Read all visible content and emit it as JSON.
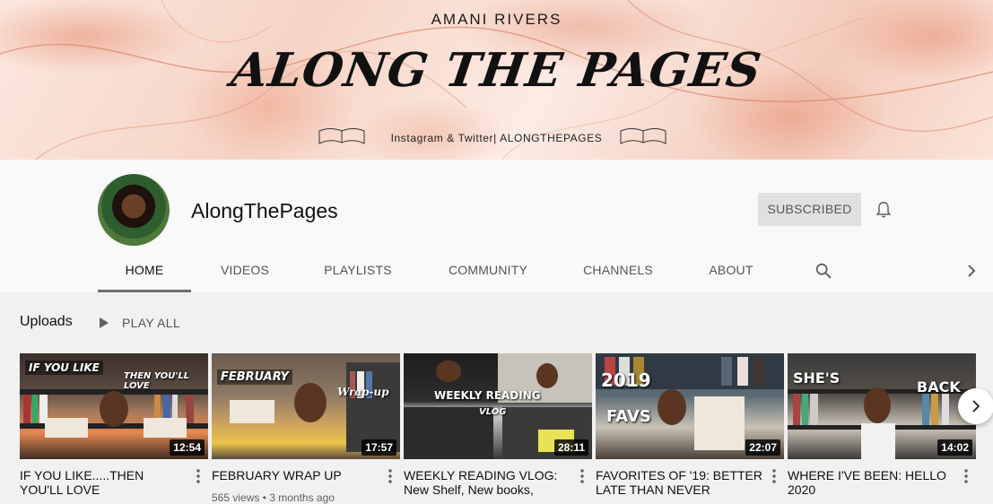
{
  "banner": {
    "name": "AMANI RIVERS",
    "title": "ALONG THE PAGES",
    "social": "Instagram & Twitter| ALONGTHEPAGES"
  },
  "channel": {
    "name": "AlongThePages",
    "subscribe_label": "SUBSCRIBED"
  },
  "tabs": [
    {
      "label": "HOME",
      "active": true
    },
    {
      "label": "VIDEOS"
    },
    {
      "label": "PLAYLISTS"
    },
    {
      "label": "COMMUNITY"
    },
    {
      "label": "CHANNELS"
    },
    {
      "label": "ABOUT"
    }
  ],
  "uploads": {
    "title": "Uploads",
    "play_all": "PLAY ALL",
    "videos": [
      {
        "title": "IF YOU LIKE.....THEN YOU'LL LOVE",
        "duration": "12:54",
        "meta": "",
        "overlay": "IF YOU LIKE",
        "overlay2": "THEN YOU'LL LOVE"
      },
      {
        "title": "FEBRUARY WRAP UP",
        "duration": "17:57",
        "meta": "565 views • 3 months ago",
        "overlay": "FEBRUARY",
        "overlay2": "Wrap-up"
      },
      {
        "title": "WEEKLY READING VLOG: New Shelf, New books, Date...",
        "duration": "28:11",
        "meta": "",
        "overlay": "WEEKLY READING",
        "overlay2": "VLOG"
      },
      {
        "title": "FAVORITES OF '19: BETTER LATE THAN NEVER",
        "duration": "22:07",
        "meta": "",
        "overlay": "2019",
        "overlay2": "FAVS"
      },
      {
        "title": "WHERE I'VE BEEN: HELLO 2020",
        "duration": "14:02",
        "meta": "",
        "overlay": "SHE'S",
        "overlay2": "BACK"
      }
    ]
  },
  "colors": {
    "page_bg": "#f1f1f1",
    "header_bg": "#f9f9f9",
    "subscribed_bg": "#e0e0e0",
    "banner_accent": "#e68c6e"
  }
}
